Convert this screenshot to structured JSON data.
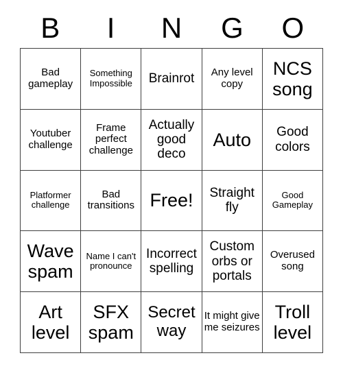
{
  "card": {
    "headers": [
      "B",
      "I",
      "N",
      "G",
      "O"
    ],
    "rows": [
      [
        {
          "text": "Bad gameplay",
          "size": "sm"
        },
        {
          "text": "Something Impossible",
          "size": "xs"
        },
        {
          "text": "Brainrot",
          "size": "md"
        },
        {
          "text": "Any level copy",
          "size": "sm"
        },
        {
          "text": "NCS song",
          "size": "xl"
        }
      ],
      [
        {
          "text": "Youtuber challenge",
          "size": "sm"
        },
        {
          "text": "Frame perfect challenge",
          "size": "sm"
        },
        {
          "text": "Actually good deco",
          "size": "md"
        },
        {
          "text": "Auto",
          "size": "xl"
        },
        {
          "text": "Good colors",
          "size": "md"
        }
      ],
      [
        {
          "text": "Platformer challenge",
          "size": "xs"
        },
        {
          "text": "Bad transitions",
          "size": "sm"
        },
        {
          "text": "Free!",
          "size": "xl"
        },
        {
          "text": "Straight fly",
          "size": "md"
        },
        {
          "text": "Good Gameplay",
          "size": "xs"
        }
      ],
      [
        {
          "text": "Wave spam",
          "size": "xl"
        },
        {
          "text": "Name I can't pronounce",
          "size": "xs"
        },
        {
          "text": "Incorrect spelling",
          "size": "md"
        },
        {
          "text": "Custom orbs or portals",
          "size": "md"
        },
        {
          "text": "Overused song",
          "size": "sm"
        }
      ],
      [
        {
          "text": "Art level",
          "size": "xl"
        },
        {
          "text": "SFX spam",
          "size": "xl"
        },
        {
          "text": "Secret way",
          "size": "lg"
        },
        {
          "text": "It might give me seizures",
          "size": "sm"
        },
        {
          "text": "Troll level",
          "size": "xl"
        }
      ]
    ]
  },
  "colors": {
    "background": "#ffffff",
    "border": "#3f3f3f",
    "text": "#000000"
  }
}
